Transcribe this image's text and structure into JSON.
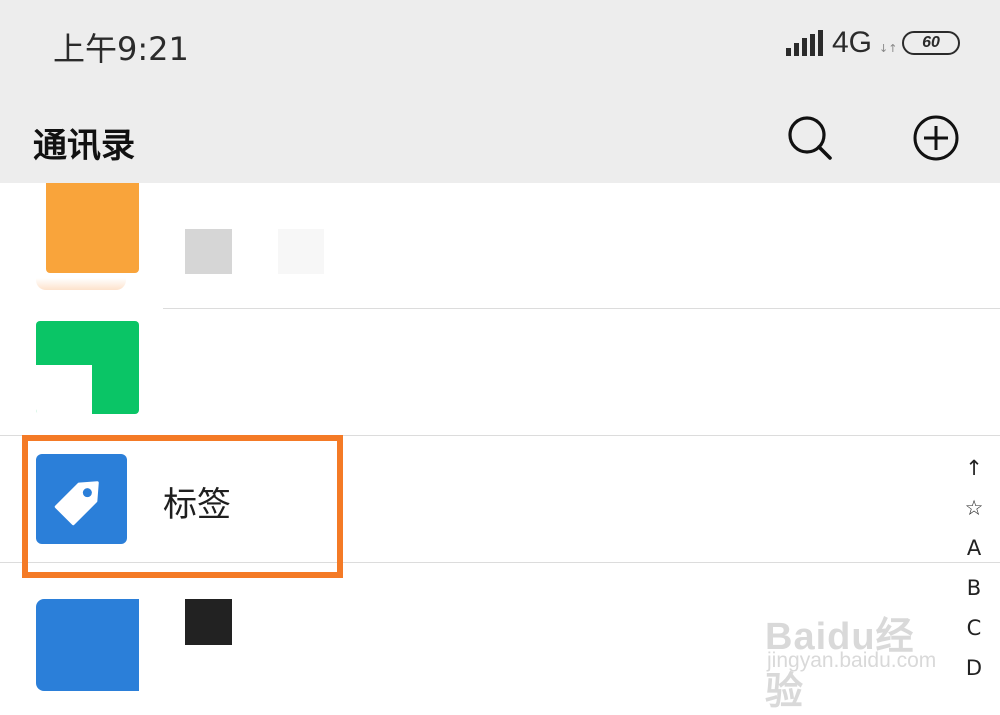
{
  "status": {
    "time": "上午9:21",
    "network": "4G",
    "data_arrows": "↓↑",
    "battery": "60"
  },
  "header": {
    "title": "通讯录",
    "search_icon": "search-icon",
    "add_icon": "plus-circle-icon"
  },
  "contacts": {
    "tag_entry": {
      "label": "标签",
      "icon": "tag-icon"
    }
  },
  "index_bar": {
    "items": [
      "↑",
      "☆",
      "A",
      "B",
      "C",
      "D"
    ]
  },
  "watermark": {
    "brand": "Baidu经验",
    "url": "jingyan.baidu.com"
  },
  "colors": {
    "header_bg": "#ededed",
    "highlight": "#f47a26",
    "tag_blue": "#2b7fd9",
    "green": "#0ac566",
    "orange": "#f9a43b"
  }
}
